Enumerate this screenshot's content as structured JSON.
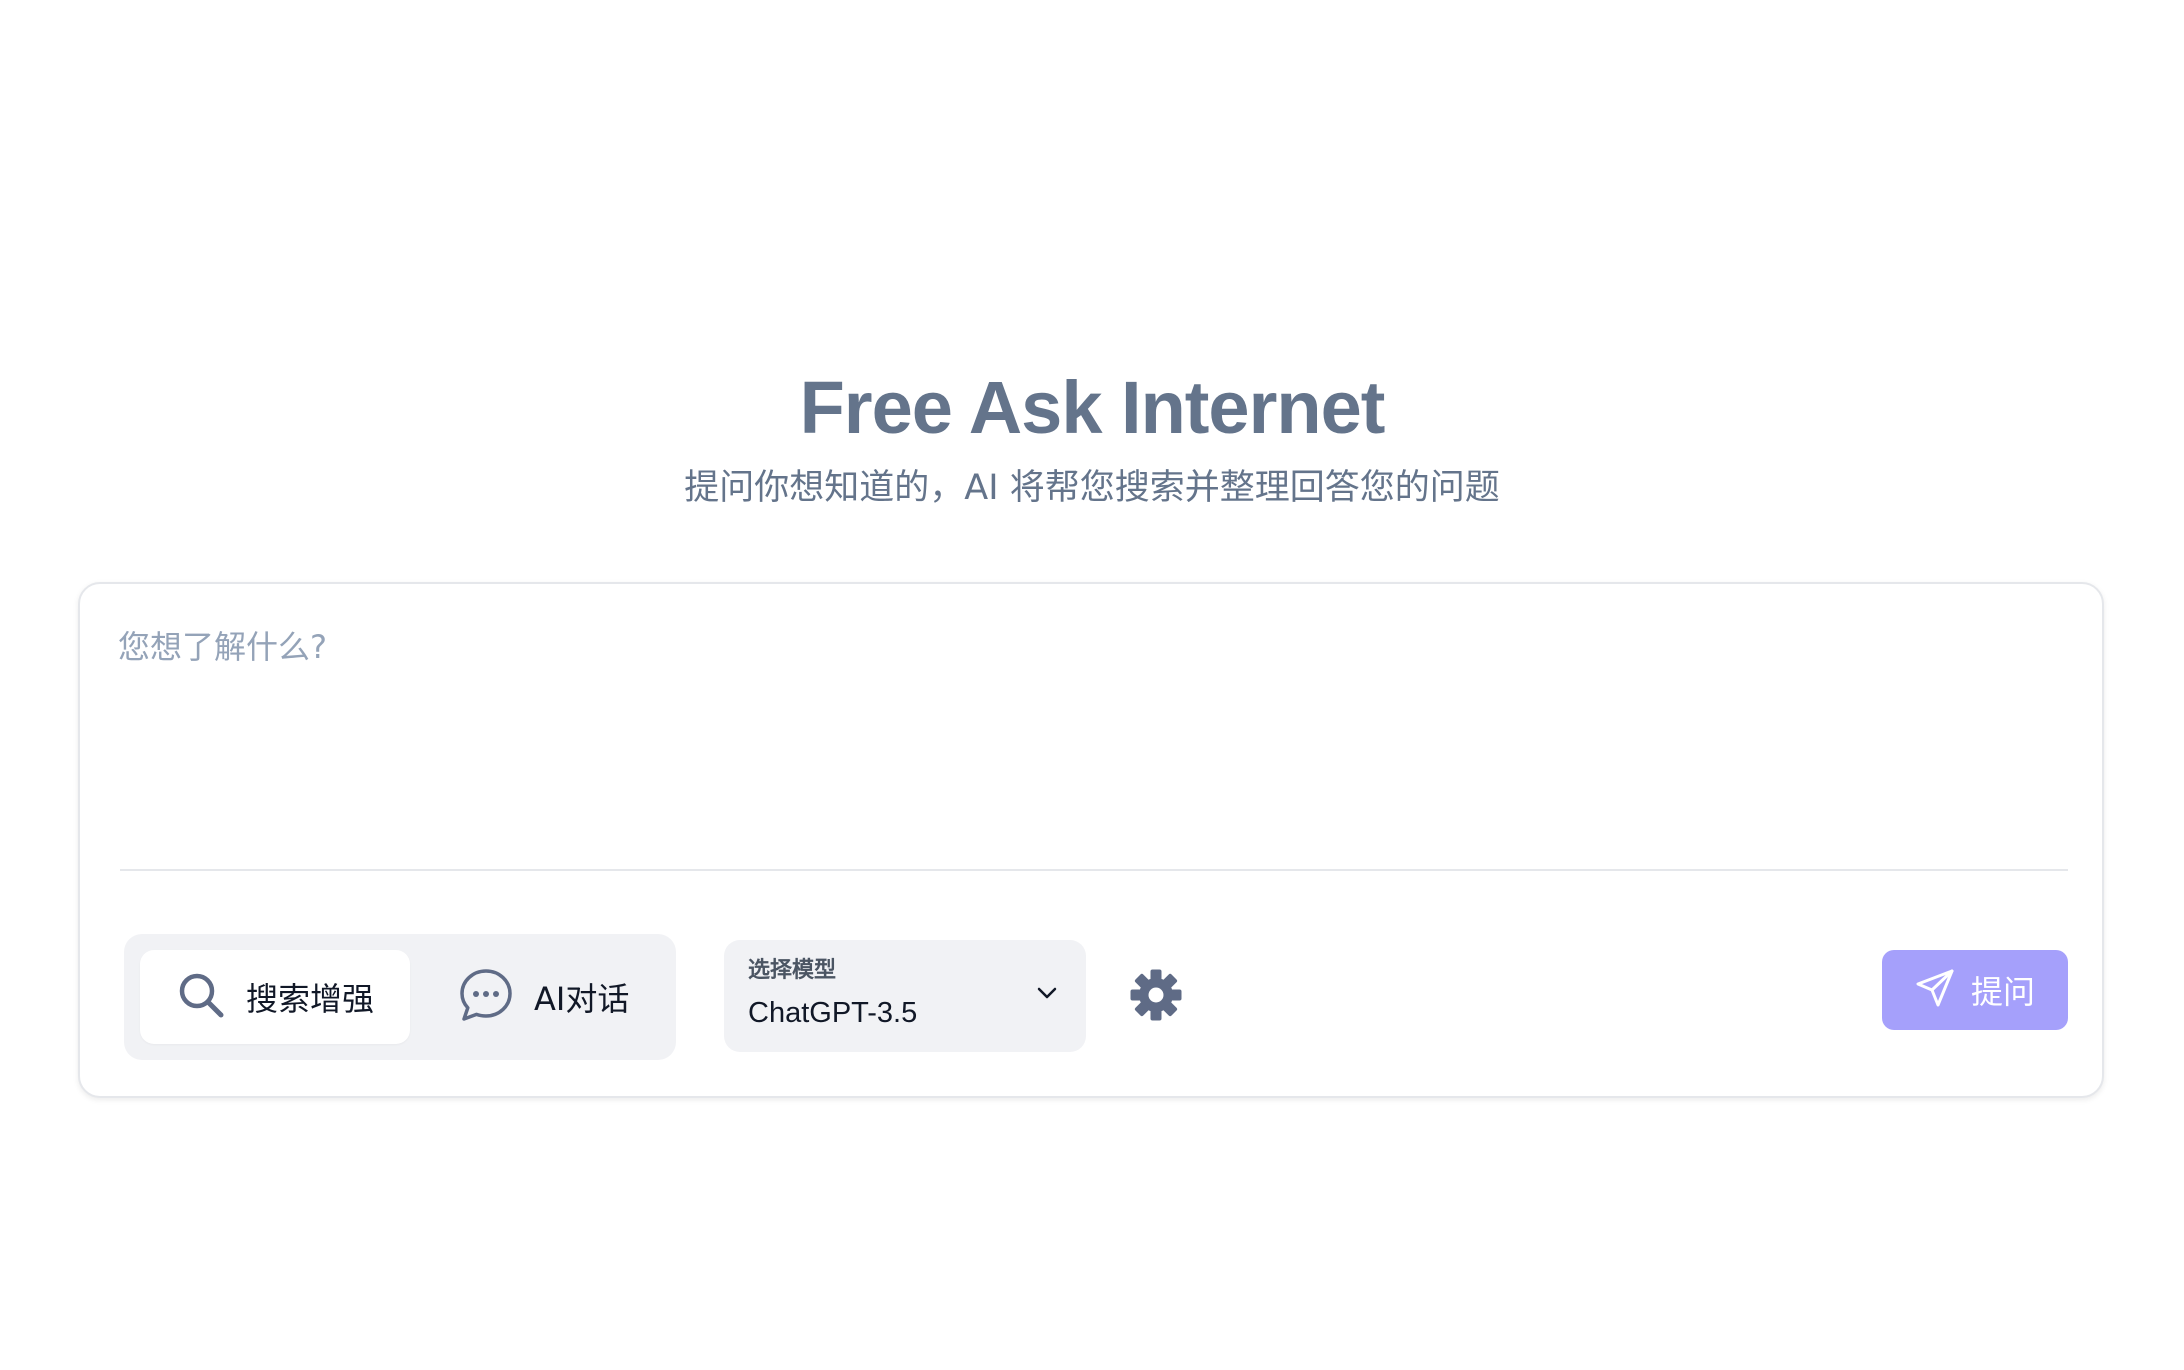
{
  "hero": {
    "title": "Free Ask Internet",
    "subtitle": "提问你想知道的，AI 将帮您搜索并整理回答您的问题"
  },
  "query": {
    "placeholder": "您想了解什么?",
    "value": ""
  },
  "modes": [
    {
      "label": "搜索增强",
      "icon": "search-icon",
      "active": true
    },
    {
      "label": "AI对话",
      "icon": "chat-bubble-icon",
      "active": false
    }
  ],
  "model_select": {
    "caption": "选择模型",
    "selected": "ChatGPT-3.5",
    "icon": "chevron-down-icon"
  },
  "settings": {
    "icon": "gear-icon"
  },
  "ask_button": {
    "label": "提问",
    "icon": "send-icon"
  },
  "colors": {
    "title": "#64748b",
    "accent_button": "#a5a0fb",
    "icon": "#5f6b86",
    "panel_bg": "#f1f2f5",
    "border": "#e5e7eb"
  }
}
